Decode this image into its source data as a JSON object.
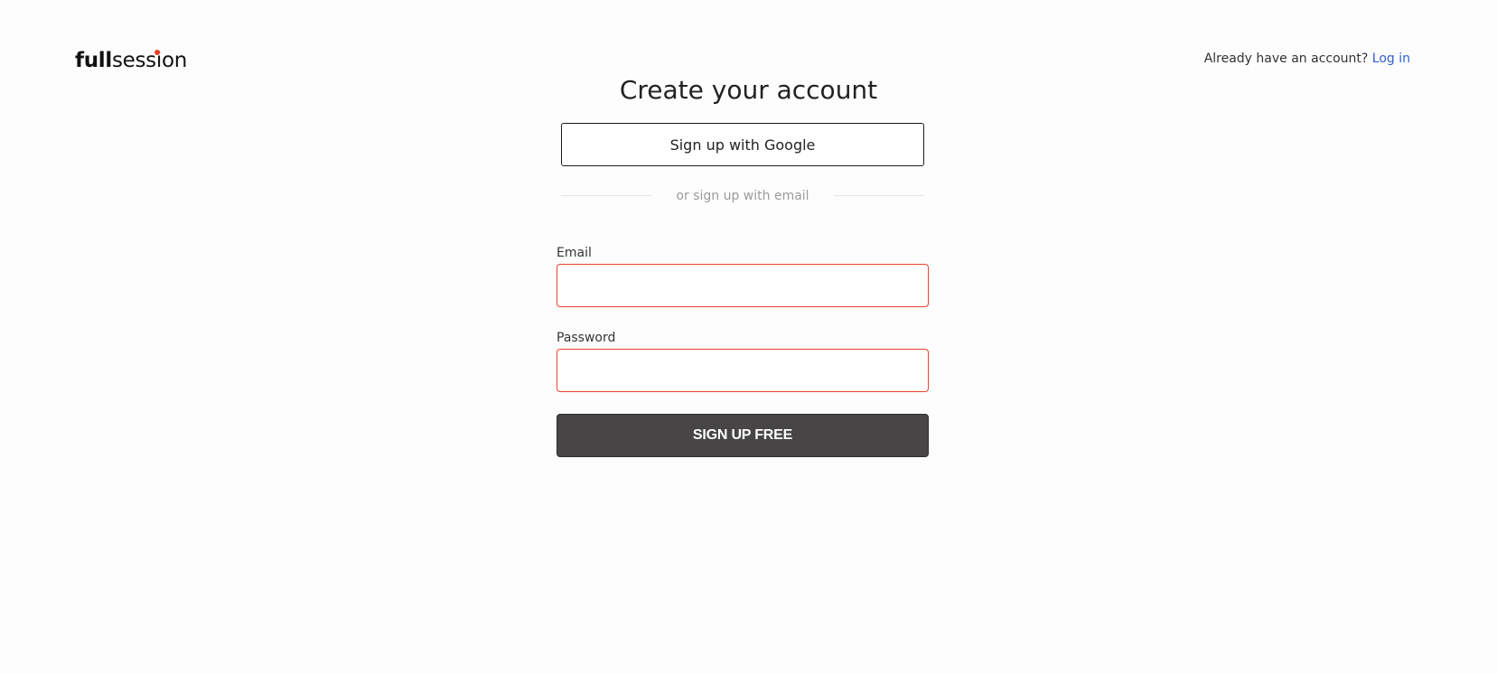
{
  "header": {
    "logo_bold": "full",
    "logo_rest": "session",
    "account_prompt": "Already have an account?",
    "login_link": "Log in"
  },
  "form": {
    "title": "Create your account",
    "google_button": "Sign up with Google",
    "divider_text": "or sign up with email",
    "email_label": "Email",
    "email_value": "",
    "password_label": "Password",
    "password_value": "",
    "submit_button": "SIGN UP FREE"
  },
  "colors": {
    "accent_error": "#e8432e",
    "link": "#2f5fd0",
    "submit_bg": "#474545"
  }
}
